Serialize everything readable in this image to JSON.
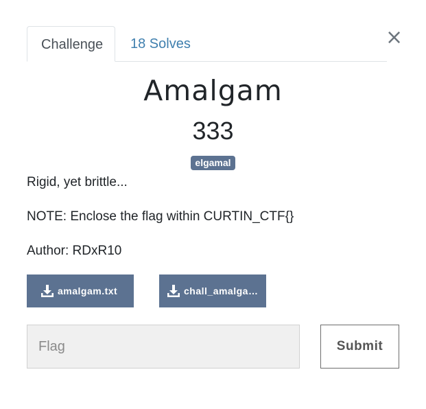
{
  "modal": {
    "close_glyph": "×",
    "tabs": [
      {
        "label": "Challenge",
        "active": true
      },
      {
        "label": "18 Solves",
        "active": false
      }
    ],
    "challenge": {
      "name": "Amalgam",
      "points": "333",
      "tag": "elgamal",
      "description": [
        "Rigid, yet brittle...",
        "NOTE: Enclose the flag within CURTIN_CTF{}",
        "Author: RDxR10"
      ],
      "files": [
        {
          "label": "amalgam.txt",
          "icon": "download-icon"
        },
        {
          "label": "chall_amalgam.py",
          "icon": "download-icon"
        }
      ]
    },
    "form": {
      "flag_placeholder": "Flag",
      "flag_value": "",
      "submit_label": "Submit"
    }
  },
  "colors": {
    "accent": "#5c7291",
    "tab_link": "#3f7fae",
    "text": "#212529"
  }
}
